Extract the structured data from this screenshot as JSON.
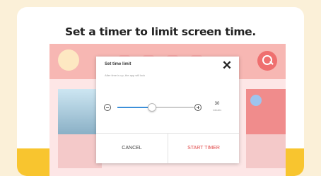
{
  "headline": "Set a timer to limit screen time.",
  "dialog": {
    "title": "Set time limit",
    "subtitle": "After time is up, the app will lock",
    "timer": {
      "value": "30",
      "unit": "minutes",
      "slider_fraction": 0.45
    },
    "cancel_label": "CANCEL",
    "start_label": "START TIMER"
  },
  "colors": {
    "accent": "#e14a4a",
    "slider": "#3c8fd9",
    "banner": "#f8c52f",
    "app_bar": "#f7b7b3"
  },
  "icons": [
    "close-icon",
    "minus-icon",
    "plus-icon",
    "search-icon"
  ]
}
